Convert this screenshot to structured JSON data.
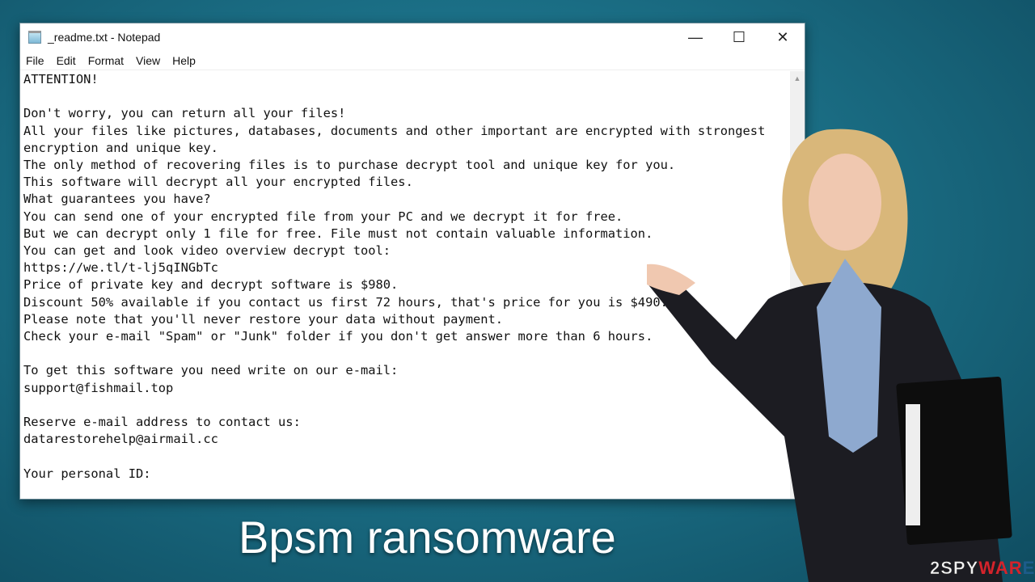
{
  "window": {
    "title": "_readme.txt - Notepad",
    "controls": {
      "minimize": "—",
      "maximize": "☐",
      "close": "✕"
    }
  },
  "menu": [
    {
      "label": "File"
    },
    {
      "label": "Edit"
    },
    {
      "label": "Format"
    },
    {
      "label": "View"
    },
    {
      "label": "Help"
    }
  ],
  "content": "ATTENTION!\n\nDon't worry, you can return all your files!\nAll your files like pictures, databases, documents and other important are encrypted with strongest\nencryption and unique key.\nThe only method of recovering files is to purchase decrypt tool and unique key for you.\nThis software will decrypt all your encrypted files.\nWhat guarantees you have?\nYou can send one of your encrypted file from your PC and we decrypt it for free.\nBut we can decrypt only 1 file for free. File must not contain valuable information.\nYou can get and look video overview decrypt tool:\nhttps://we.tl/t-lj5qINGbTc\nPrice of private key and decrypt software is $980.\nDiscount 50% available if you contact us first 72 hours, that's price for you is $490.\nPlease note that you'll never restore your data without payment.\nCheck your e-mail \"Spam\" or \"Junk\" folder if you don't get answer more than 6 hours.\n\nTo get this software you need write on our e-mail:\nsupport@fishmail.top\n\nReserve e-mail address to contact us:\ndatarestorehelp@airmail.cc\n\nYour personal ID:",
  "caption": "Bpsm ransomware",
  "logo": {
    "part1": "2SPY",
    "part2": "WAR",
    "part3": "E"
  }
}
